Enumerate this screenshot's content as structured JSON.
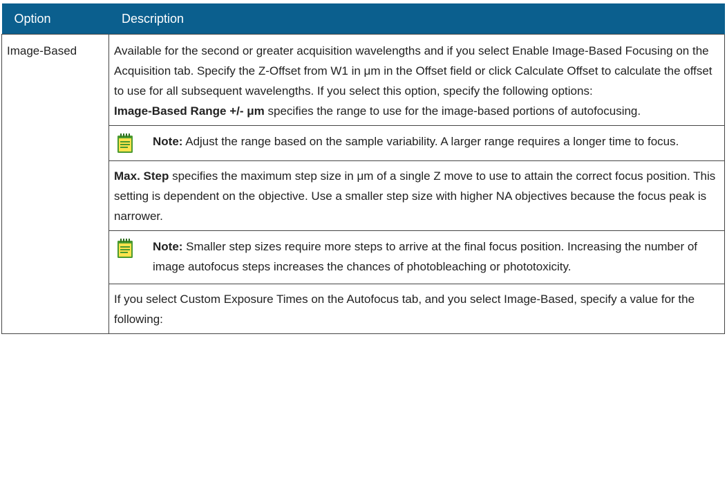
{
  "table": {
    "header_option": "Option",
    "header_description": "Description",
    "row_option": "Image-Based",
    "intro_paragraph": "Available for the second or greater acquisition wavelengths and if you select Enable Image-Based Focusing on the Acquisition tab. Specify the Z-Offset from W1 in μm in the Offset field or click Calculate Offset to calculate the offset to use for all subsequent wavelengths. If you select this option, specify the following options:",
    "range_term": "Image-Based Range +/- μm",
    "range_text": " specifies the range to use for the image-based portions of autofocusing.",
    "note1_label": "Note:",
    "note1_text": " Adjust the range based on the sample variability. A larger range requires a longer time to focus.",
    "maxstep_term": "Max. Step",
    "maxstep_text": " specifies the maximum step size in μm of a single Z move to use to attain the correct focus position. This setting is dependent on the objective. Use a smaller step size with higher NA objectives because the focus peak is narrower.",
    "note2_label": "Note:",
    "note2_text": " Smaller step sizes require more steps to arrive at the final focus position. Increasing the number of image autofocus steps increases the chances of photobleaching or phototoxicity.",
    "custom_paragraph": "If you select Custom Exposure Times on the Autofocus tab, and you select Image-Based, specify a value for the following:"
  },
  "colors": {
    "header_bg": "#0b5f8e",
    "note_icon_green": "#4a9a2f"
  },
  "icons": {
    "note": "note-icon"
  }
}
